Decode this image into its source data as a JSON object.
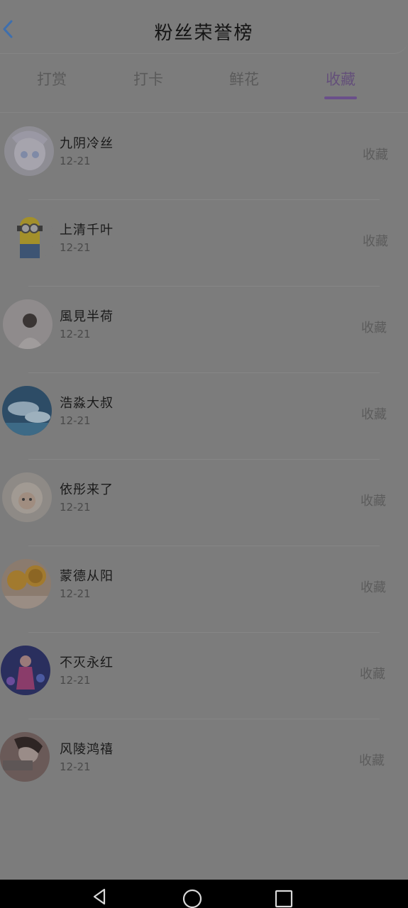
{
  "header": {
    "title": "粉丝荣誉榜",
    "back_icon": "chevron-left-icon",
    "accent": "#4a7fc0"
  },
  "tabs": [
    {
      "label": "打赏",
      "active": false
    },
    {
      "label": "打卡",
      "active": false
    },
    {
      "label": "鲜花",
      "active": false
    },
    {
      "label": "收藏",
      "active": true
    }
  ],
  "fans": [
    {
      "name": "九阴冷丝",
      "date": "12-21",
      "action": "收藏"
    },
    {
      "name": "上清千叶",
      "date": "12-21",
      "action": "收藏"
    },
    {
      "name": "風見半荷",
      "date": "12-21",
      "action": "收藏"
    },
    {
      "name": "浩淼大叔",
      "date": "12-21",
      "action": "收藏"
    },
    {
      "name": "依彤来了",
      "date": "12-21",
      "action": "收藏"
    },
    {
      "name": "蒙德从阳",
      "date": "12-21",
      "action": "收藏"
    },
    {
      "name": "不灭永红",
      "date": "12-21",
      "action": "收藏"
    },
    {
      "name": "风陵鸿禧",
      "date": "12-21",
      "action": "收藏"
    }
  ],
  "navbar": {
    "back_icon": "triangle-back-icon",
    "home_icon": "circle-home-icon",
    "recents_icon": "square-recents-icon"
  }
}
